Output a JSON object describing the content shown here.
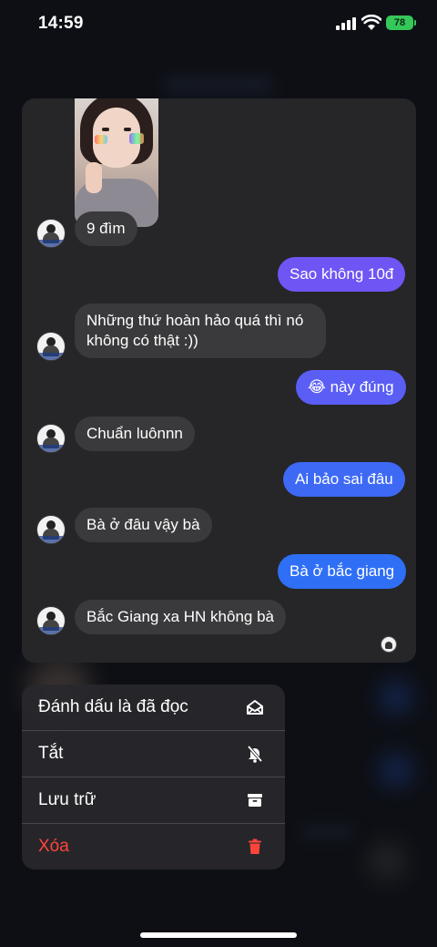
{
  "status_bar": {
    "time": "14:59",
    "battery": "78"
  },
  "conversation": {
    "messages": [
      {
        "dir": "in",
        "text": "9 đìm"
      },
      {
        "dir": "out",
        "text": "Sao không 10đ"
      },
      {
        "dir": "in",
        "text_line1": "Những thứ hoàn hảo quá thì nó",
        "text_line2": "không có thật :))"
      },
      {
        "dir": "out",
        "text": "😂 này đúng"
      },
      {
        "dir": "in",
        "text": "Chuẩn luônnn"
      },
      {
        "dir": "out",
        "text": "Ai bảo sai đâu"
      },
      {
        "dir": "in",
        "text": "Bà ở đâu vậy bà"
      },
      {
        "dir": "out",
        "text": "Bà ở bắc giang"
      },
      {
        "dir": "in",
        "text": "Bắc Giang xa HN không bà"
      }
    ]
  },
  "menu": {
    "items": [
      {
        "label": "Đánh dấu là đã đọc",
        "icon": "mark-read-envelope-icon"
      },
      {
        "label": "Tắt",
        "icon": "bell-slash-icon"
      },
      {
        "label": "Lưu trữ",
        "icon": "archive-box-icon"
      },
      {
        "label": "Xóa",
        "icon": "trash-icon"
      }
    ]
  },
  "colors": {
    "card_bg": "#262628",
    "incoming_bubble": "#3a3a3c",
    "outgoing_purple": "#6e55f4",
    "outgoing_blue": "#2f6ff5",
    "delete_red": "#ff453a",
    "battery_green": "#34c759"
  }
}
